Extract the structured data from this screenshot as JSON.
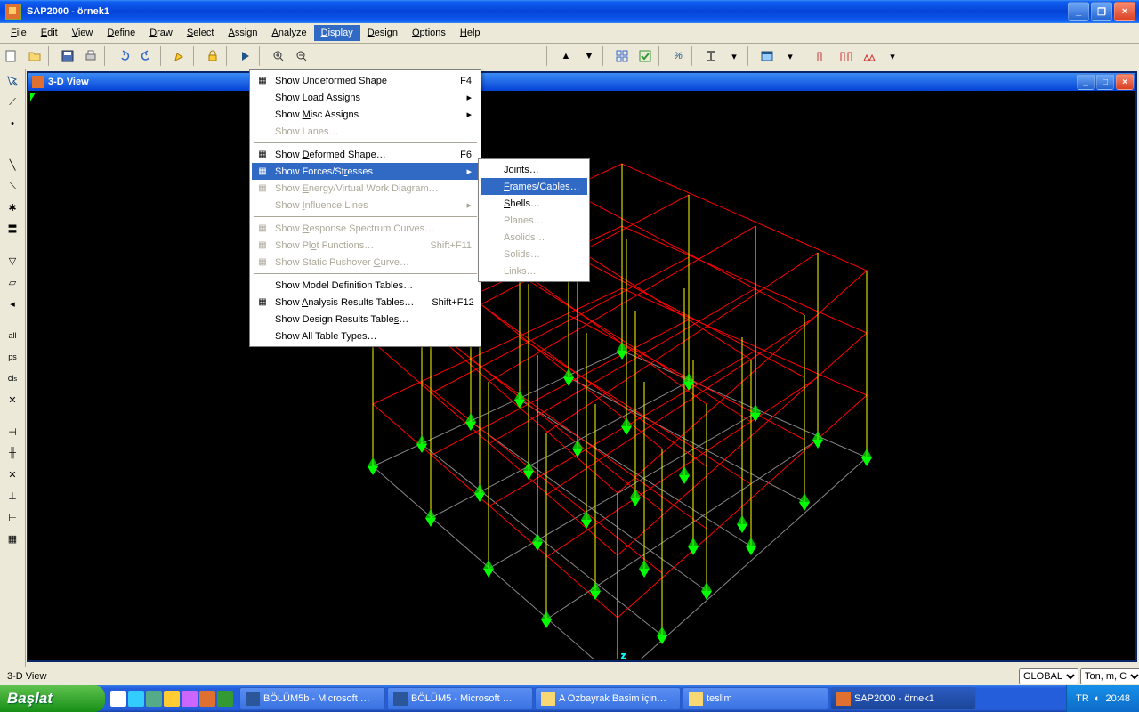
{
  "app": {
    "title": "SAP2000 - örnek1"
  },
  "menubar": {
    "items": [
      "File",
      "Edit",
      "View",
      "Define",
      "Draw",
      "Select",
      "Assign",
      "Analyze",
      "Display",
      "Design",
      "Options",
      "Help"
    ],
    "active": 8
  },
  "docwin": {
    "title": "3-D View"
  },
  "display_menu": {
    "items": [
      {
        "label": "Show Undeformed Shape",
        "kb": "F4",
        "u": 5,
        "ico": "square"
      },
      {
        "label": "Show Load Assigns",
        "sub": true
      },
      {
        "label": "Show Misc Assigns",
        "u": 5,
        "sub": true
      },
      {
        "label": "Show Lanes…",
        "dis": true
      },
      {
        "sep": true
      },
      {
        "label": "Show  Deformed Shape…",
        "kb": "F6",
        "u": 6,
        "ico": "deform"
      },
      {
        "label": "Show Forces/Stresses",
        "u": 14,
        "sub": true,
        "hl": true,
        "ico": "force"
      },
      {
        "label": "Show Energy/Virtual Work Diagram…",
        "u": 5,
        "dis": true,
        "ico": "bolt"
      },
      {
        "label": "Show Influence Lines",
        "u": 5,
        "dis": true,
        "sub": true
      },
      {
        "sep": true
      },
      {
        "label": "Show Response Spectrum Curves…",
        "u": 5,
        "dis": true,
        "ico": "chart"
      },
      {
        "label": "Show Plot Functions…",
        "u": 7,
        "kb": "Shift+F11",
        "dis": true,
        "ico": "plot"
      },
      {
        "label": "Show Static Pushover Curve…",
        "u": 21,
        "dis": true,
        "ico": "push"
      },
      {
        "sep": true
      },
      {
        "label": "Show Model Definition Tables…"
      },
      {
        "label": "Show Analysis Results Tables…",
        "u": 5,
        "kb": "Shift+F12",
        "ico": "table"
      },
      {
        "label": "Show Design Results Tables…",
        "u": 25
      },
      {
        "label": "Show All Table Types…"
      }
    ]
  },
  "forces_submenu": {
    "items": [
      {
        "label": "Joints…",
        "u": 0
      },
      {
        "label": "Frames/Cables…",
        "u": 0,
        "hl": true
      },
      {
        "label": "Shells…",
        "u": 0
      },
      {
        "label": "Planes…",
        "dis": true
      },
      {
        "label": "Asolids…",
        "dis": true
      },
      {
        "label": "Solids…",
        "dis": true
      },
      {
        "label": "Links…",
        "dis": true
      }
    ]
  },
  "statusbar": {
    "left": "3-D View",
    "combo1": "GLOBAL",
    "combo2": "Ton, m, C"
  },
  "taskbar": {
    "start": "Başlat",
    "tasks": [
      {
        "label": "BÖLÜM5b - Microsoft …",
        "icon": "#2b579a"
      },
      {
        "label": "BÖLÜM5 - Microsoft …",
        "icon": "#2b579a"
      },
      {
        "label": "A Ozbayrak Basim için…",
        "icon": "#f8d775"
      },
      {
        "label": "teslim",
        "icon": "#f8d775"
      },
      {
        "label": "SAP2000 - örnek1",
        "icon": "#e07030",
        "active": true
      }
    ],
    "lang": "TR",
    "clock": "20:48"
  }
}
